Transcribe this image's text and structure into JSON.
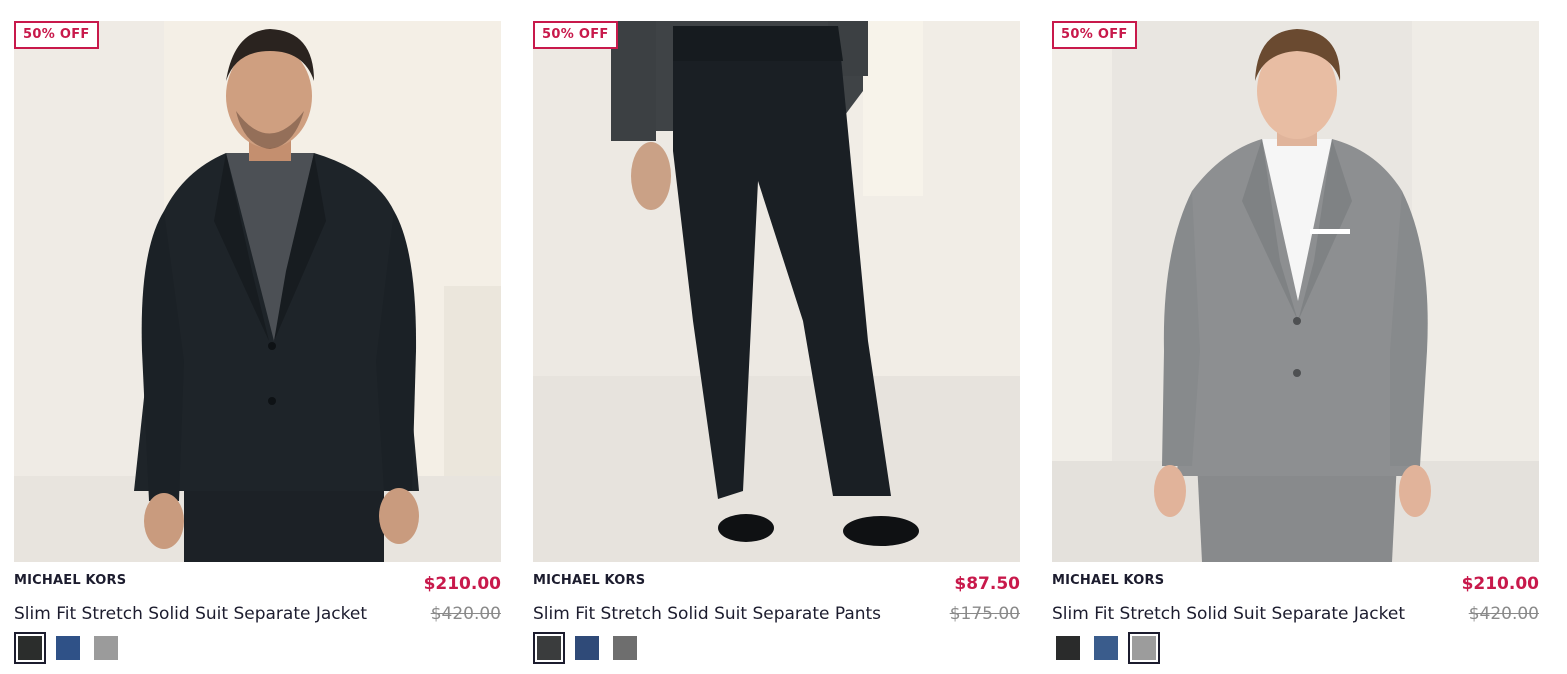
{
  "products": [
    {
      "badge": "50% OFF",
      "brand": "MICHAEL KORS",
      "name": "Slim Fit Stretch Solid Suit Separate Jacket",
      "sale_price": "$210.00",
      "original_price": "$420.00",
      "image_icon": "model-black-suit-jacket",
      "swatches": [
        {
          "name": "black",
          "color": "#2b2d2c",
          "selected": true
        },
        {
          "name": "blue",
          "color": "#2f5187",
          "selected": false
        },
        {
          "name": "grey",
          "color": "#9b9b9b",
          "selected": false
        }
      ]
    },
    {
      "badge": "50% OFF",
      "brand": "MICHAEL KORS",
      "name": "Slim Fit Stretch Solid Suit Separate Pants",
      "sale_price": "$87.50",
      "original_price": "$175.00",
      "image_icon": "model-black-suit-pants",
      "swatches": [
        {
          "name": "black",
          "color": "#3a3c3d",
          "selected": true
        },
        {
          "name": "blue",
          "color": "#2f4a78",
          "selected": false
        },
        {
          "name": "grey",
          "color": "#6e6e6e",
          "selected": false
        }
      ]
    },
    {
      "badge": "50% OFF",
      "brand": "MICHAEL KORS",
      "name": "Slim Fit Stretch Solid Suit Separate Jacket",
      "sale_price": "$210.00",
      "original_price": "$420.00",
      "image_icon": "model-grey-suit-jacket",
      "swatches": [
        {
          "name": "black",
          "color": "#2a2b2b",
          "selected": false
        },
        {
          "name": "blue",
          "color": "#3a5c8c",
          "selected": false
        },
        {
          "name": "grey",
          "color": "#9c9c9c",
          "selected": true
        }
      ]
    }
  ],
  "colors": {
    "accent": "#c8194b",
    "text": "#1c1c2e",
    "muted": "#8a8a8a"
  }
}
